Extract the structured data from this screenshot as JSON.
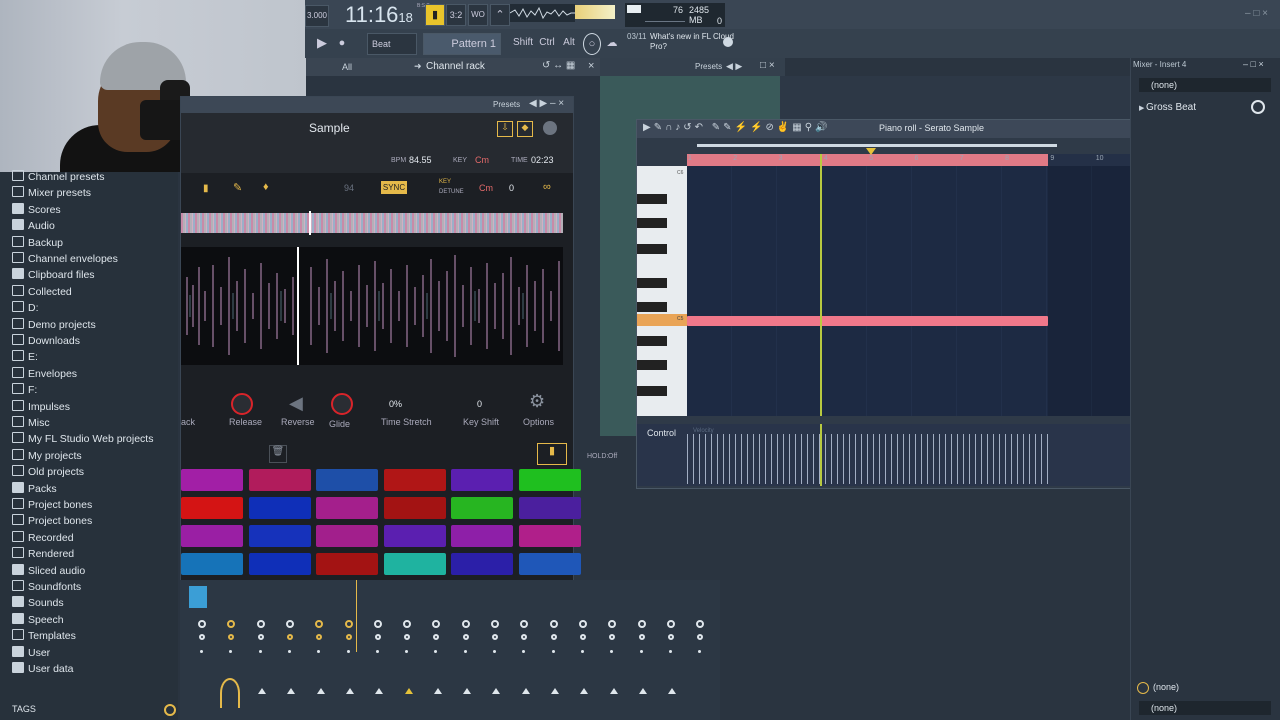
{
  "toolbar": {
    "clock_main": "11:16",
    "clock_sub": "18",
    "clock_unit": "B:S:T",
    "tempo_box": "3.000",
    "cpu_value": "76",
    "mem_value": "2485 MB",
    "poly_value": "0",
    "snap_label": "Beat",
    "pattern_label": "Pattern 1",
    "shift_label": "Shift",
    "ctrl_label": "Ctrl",
    "alt_label": "Alt",
    "news_date": "03/11",
    "news_text": "What's new in FL Cloud Pro?"
  },
  "channel_rack_bar": {
    "filter": "All",
    "title": "Channel rack",
    "presets_label": "Presets"
  },
  "browser": {
    "items": [
      "Channel presets",
      "Mixer presets",
      "Scores",
      "Audio",
      "Backup",
      "Channel envelopes",
      "Clipboard files",
      "Collected",
      "D:",
      "Demo projects",
      "Downloads",
      "E:",
      "Envelopes",
      "F:",
      "Impulses",
      "Misc",
      "My FL Studio Web projects",
      "My projects",
      "Old projects",
      "Packs",
      "Project bones",
      "Project bones",
      "Recorded",
      "Rendered",
      "Sliced audio",
      "Soundfonts",
      "Sounds",
      "Speech",
      "Templates",
      "User",
      "User data"
    ],
    "tags_label": "TAGS"
  },
  "serato": {
    "presets_label": "Presets",
    "sample_label": "Sample",
    "bpm_label": "BPM",
    "bpm_value": "84.55",
    "key_label": "KEY",
    "key_value": "Cm",
    "time_label": "TIME",
    "time_value": "02:23",
    "sync_label": "SYNC",
    "tempo_field": "94",
    "key_detune_label": "KEY",
    "detune_label": "DETUNE",
    "key_select": "Cm",
    "detune_value": "0",
    "knob_labels": [
      "Release",
      "Reverse",
      "Glide",
      "Time Stretch",
      "Key Shift",
      "Options"
    ],
    "stretch_value": "0%",
    "keyshift_value": "0",
    "back_label": "ack",
    "hold_label": "HOLD:",
    "hold_value": "Off",
    "pad_colors": [
      [
        "#a21fa6",
        "#b11c5c",
        "#1e4fa8",
        "#b01616",
        "#5b1fb0",
        "#1fbf1f"
      ],
      [
        "#d41414",
        "#0f2fb8",
        "#a41f8c",
        "#a31313",
        "#27b521",
        "#4b1f9e"
      ],
      [
        "#9a1fa4",
        "#1632bb",
        "#a21f8c",
        "#5b1fb0",
        "#8e1fa8",
        "#b01f8a"
      ],
      [
        "#1673b8",
        "#0f2fb8",
        "#a31313",
        "#1fb3a0",
        "#2b1fa8",
        "#1f57b8"
      ]
    ]
  },
  "piano_roll": {
    "title": "Piano roll - Serato Sample",
    "ruler_numbers": [
      "1",
      "2",
      "3",
      "4",
      "5",
      "6",
      "7",
      "8",
      "9",
      "10",
      "11",
      "12",
      "13"
    ],
    "key_label_c6": "C6",
    "key_label_c5": "C5",
    "control_label": "Control",
    "velocity_label": "Velocity"
  },
  "mixer": {
    "title": "Mixer - Insert 4",
    "slot_top": "(none)",
    "insert_name": "Gross Beat",
    "slot_bottom_1": "(none)",
    "slot_bottom_2": "(none)"
  }
}
